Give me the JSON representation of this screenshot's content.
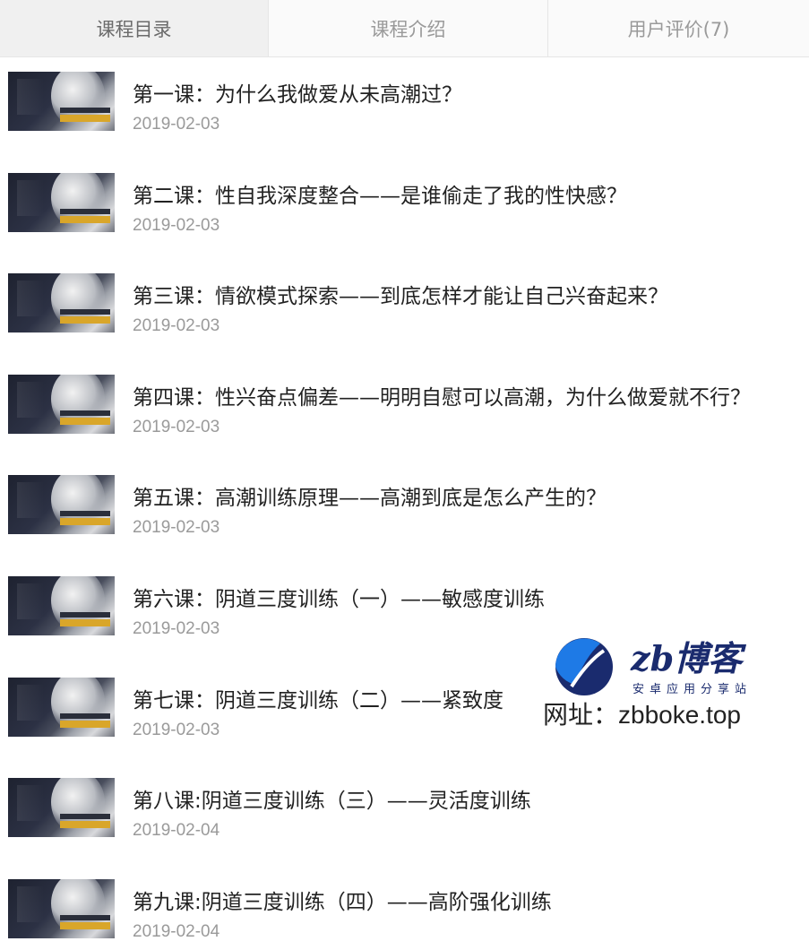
{
  "tabs": [
    {
      "label": "课程目录",
      "active": true
    },
    {
      "label": "课程介绍",
      "active": false
    },
    {
      "label": "用户评价(7)",
      "active": false
    }
  ],
  "lessons": [
    {
      "title": "第一课：为什么我做爱从未高潮过？",
      "date": "2019-02-03"
    },
    {
      "title": "第二课：性自我深度整合——是谁偷走了我的性快感？",
      "date": "2019-02-03"
    },
    {
      "title": "第三课：情欲模式探索——到底怎样才能让自己兴奋起来？",
      "date": "2019-02-03"
    },
    {
      "title": "第四课：性兴奋点偏差——明明自慰可以高潮，为什么做爱就不行？",
      "date": "2019-02-03"
    },
    {
      "title": "第五课：高潮训练原理——高潮到底是怎么产生的？",
      "date": "2019-02-03"
    },
    {
      "title": "第六课：阴道三度训练（一）——敏感度训练",
      "date": "2019-02-03"
    },
    {
      "title": "第七课：阴道三度训练（二）——紧致度",
      "date": "2019-02-03"
    },
    {
      "title": "第八课:阴道三度训练（三）——灵活度训练",
      "date": "2019-02-04"
    },
    {
      "title": "第九课:阴道三度训练（四）——高阶强化训练",
      "date": "2019-02-04"
    }
  ],
  "watermark": {
    "brand": "zb博客",
    "subtitle": "安卓应用分享站",
    "url": "网址：zbboke.top",
    "logo_color": "#1e7ae6",
    "logo_dark_color": "#1a2b6e"
  }
}
